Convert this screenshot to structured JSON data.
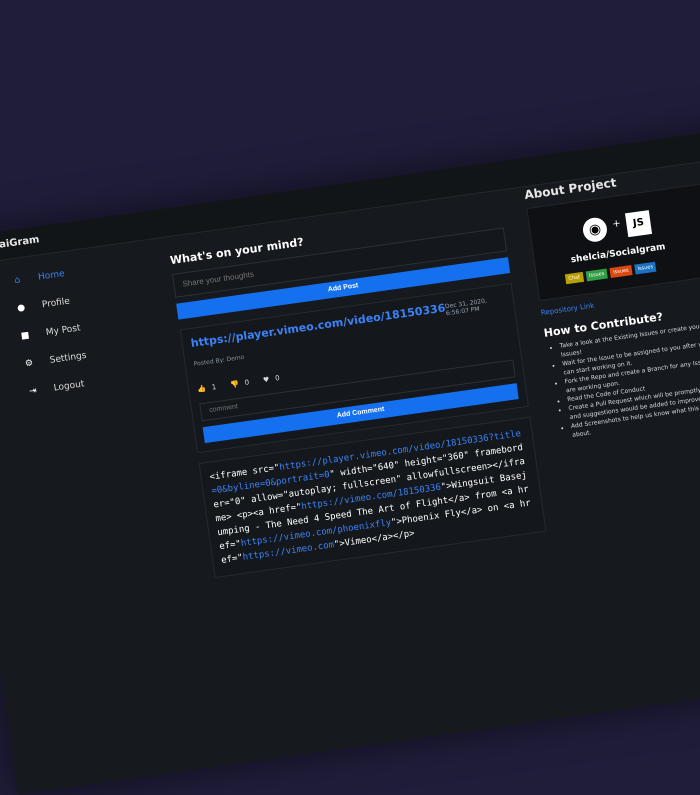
{
  "app": {
    "title": "aiGram"
  },
  "sidebar": {
    "items": [
      {
        "label": "Home",
        "icon": "home-icon",
        "active": true
      },
      {
        "label": "Profile",
        "icon": "user-icon",
        "active": false
      },
      {
        "label": "My Post",
        "icon": "post-icon",
        "active": false
      },
      {
        "label": "Settings",
        "icon": "gear-icon",
        "active": false
      },
      {
        "label": "Logout",
        "icon": "logout-icon",
        "active": false
      }
    ]
  },
  "composer": {
    "title": "What's on your mind?",
    "placeholder": "Share your thoughts",
    "add_post": "Add Post"
  },
  "post": {
    "link": "https://player.vimeo.com/video/18150336",
    "date": "Dec 31, 2020, 6:56:07 PM",
    "posted_by": "Posted By: Demo",
    "likes": "1",
    "dislikes": "0",
    "hearts": "0",
    "comment_placeholder": "comment",
    "add_comment": "Add Comment"
  },
  "post2": {
    "p1": "<iframe src=\"",
    "l1": "https://player.vimeo.com/video/18150336?title=0&byline=0&portrait=0",
    "p2": "\" width=\"640\" height=\"360\" frameborder=\"0\" allow=\"autoplay; fullscreen\" allowfullscreen></iframe> <p><a href=\"",
    "l2": "https://vimeo.com/18150336",
    "p3": "\">Wingsuit Basejumping - The Need 4 Speed The Art of Flight</a> from <a href=\"",
    "l3": "https://vimeo.com/phoenixfly",
    "p4": "\">Phoenix Fly</a> on <a href=\"",
    "l4": "https://vimeo.com",
    "p5": "\">Vimeo</a></p>"
  },
  "about": {
    "title": "About Project",
    "repo_name": "shelcia/Socialgram",
    "badges": [
      "Chat",
      "Issues",
      "Issues",
      "Issues"
    ],
    "repo_link": "Repository Link",
    "contribute_title": "How to Contribute?",
    "steps": [
      "Take a look at the Existing Issues or create your own Issues!",
      "Wait for the Issue to be assigned to you after which you can start working on it.",
      "Fork the Repo and create a Branch for any Issue that you are working upon.",
      "Read the Code of Conduct",
      "Create a Pull Request which will be promptly reviewed and suggestions would be added to improve it.",
      "Add Screenshots to help us know what this Script is all about."
    ]
  },
  "colors": {
    "accent": "#1570ef",
    "background": "#1f1d3a",
    "panel": "#161a1f"
  }
}
